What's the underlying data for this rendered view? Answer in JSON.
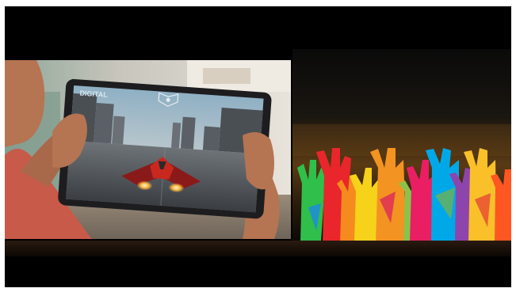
{
  "scene": {
    "left_photo": "person-holding-tablet-playing-racing-game",
    "right_artwork": "colorful-polygon-raised-hands-under-dusk-sky"
  },
  "tablet_game": {
    "hud_left_text": "DIGITAL",
    "hud_center_icon": "shield-emblem-icon"
  },
  "colors": {
    "background": "#000000",
    "skin": "#b57452",
    "shirt": "#c85a4a",
    "tablet_bezel": "#1d1d1f",
    "sky_top": "#0a0a0a",
    "sky_glow": "#7a4a1a"
  }
}
